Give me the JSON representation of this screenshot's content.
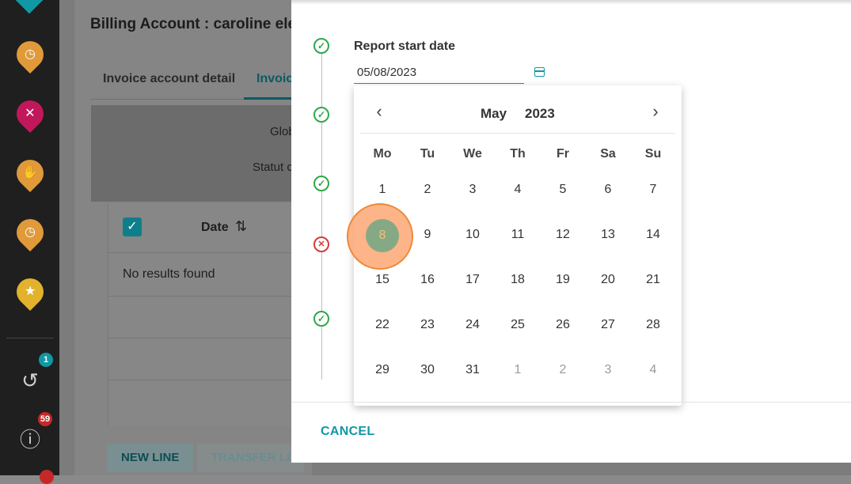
{
  "background": {
    "title": "Billing Account : caroline ele",
    "tabs": [
      {
        "label": "Invoice account detail"
      },
      {
        "label": "Invoic"
      }
    ],
    "filters": [
      "Glob",
      "Statut c"
    ],
    "table": {
      "select_all_checked": true,
      "date_header": "Date",
      "empty_text": "No results found"
    },
    "buttons": {
      "new_line": "NEW LINE",
      "transfer_line": "TRANSFER LI"
    }
  },
  "sidebar": {
    "pins": [
      {
        "icon": "clock-pin-icon",
        "color": "#e09a3a"
      },
      {
        "icon": "cutlery-pin-icon",
        "color": "#c2185b"
      },
      {
        "icon": "hand-pin-icon",
        "color": "#e09a3a"
      },
      {
        "icon": "clock-pin-icon",
        "color": "#e09a3a"
      },
      {
        "icon": "star-pin-icon",
        "color": "#e3b22c"
      }
    ],
    "history_badge": "1",
    "info_badge": "59"
  },
  "modal": {
    "field_label": "Report start date",
    "date_value": "05/08/2023",
    "steps": [
      {
        "status": "ok"
      },
      {
        "status": "ok"
      },
      {
        "status": "ok"
      },
      {
        "status": "error"
      },
      {
        "status": "ok"
      }
    ],
    "calendar": {
      "month": "May",
      "year": "2023",
      "weekdays": [
        "Mo",
        "Tu",
        "We",
        "Th",
        "Fr",
        "Sa",
        "Su"
      ],
      "weeks": [
        [
          "1",
          "2",
          "3",
          "4",
          "5",
          "6",
          "7"
        ],
        [
          "8",
          "9",
          "10",
          "11",
          "12",
          "13",
          "14"
        ],
        [
          "15",
          "16",
          "17",
          "18",
          "19",
          "20",
          "21"
        ],
        [
          "22",
          "23",
          "24",
          "25",
          "26",
          "27",
          "28"
        ],
        [
          "29",
          "30",
          "31",
          "1",
          "2",
          "3",
          "4"
        ]
      ],
      "selected_day": "8"
    },
    "cancel_label": "CANCEL"
  },
  "colors": {
    "accent": "#1198a4",
    "success": "#2ea84a",
    "error": "#d93838",
    "selected_day": "#86a985",
    "click_highlight": "#fda773"
  }
}
